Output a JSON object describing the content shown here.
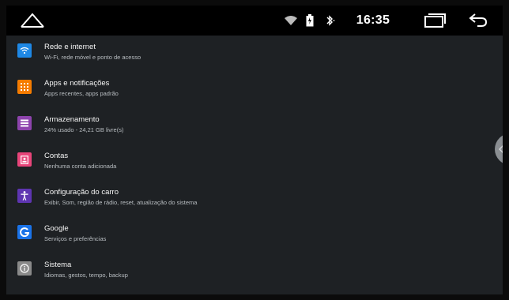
{
  "status_bar": {
    "time": "16:35",
    "icons": [
      "home-icon",
      "wifi-icon",
      "battery-icon",
      "bluetooth-icon",
      "recents-icon",
      "back-icon"
    ]
  },
  "settings": {
    "items": [
      {
        "title": "Rede e internet",
        "subtitle": "Wi-Fi, rede móvel e ponto de acesso",
        "icon": "wifi-icon",
        "color": "#1e88e5"
      },
      {
        "title": "Apps e notificações",
        "subtitle": "Apps recentes, apps padrão",
        "icon": "apps-grid-icon",
        "color": "#f57c00"
      },
      {
        "title": "Armazenamento",
        "subtitle": "24% usado - 24,21 GB livre(s)",
        "icon": "storage-icon",
        "color": "#8e44ad"
      },
      {
        "title": "Contas",
        "subtitle": "Nenhuma conta adicionada",
        "icon": "account-icon",
        "color": "#e8457a"
      },
      {
        "title": "Configuração do carro",
        "subtitle": "Exibir, Som, região de rádio, reset, atualização do sistema",
        "icon": "accessibility-icon",
        "color": "#5e35b1"
      },
      {
        "title": "Google",
        "subtitle": "Serviços e preferências",
        "icon": "google-icon",
        "color": "#1a73e8"
      },
      {
        "title": "Sistema",
        "subtitle": "Idiomas, gestos, tempo, backup",
        "icon": "info-icon",
        "color": "#8a8a8a"
      }
    ]
  }
}
